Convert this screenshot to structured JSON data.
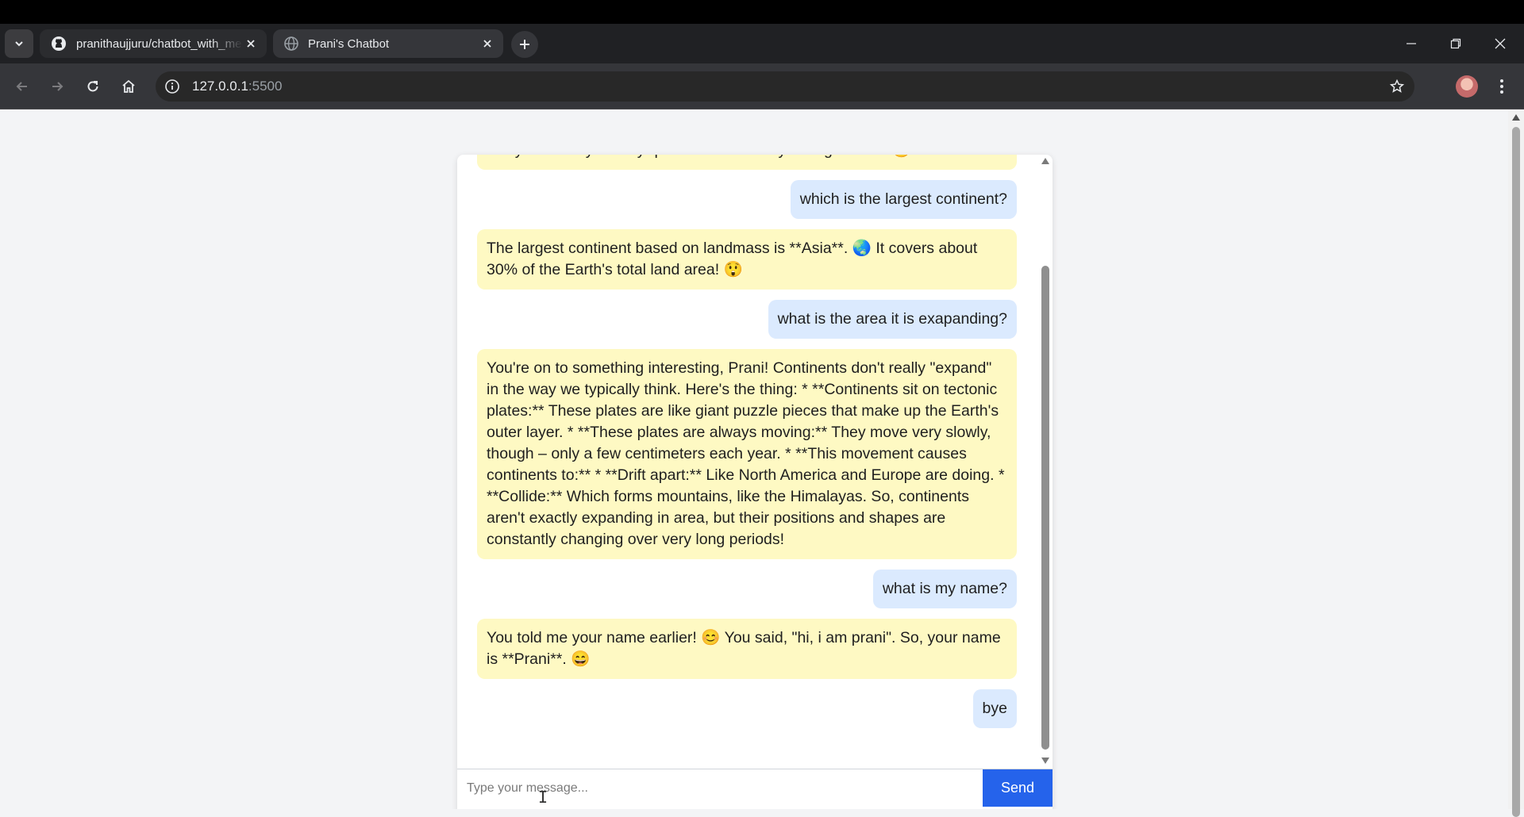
{
  "browser": {
    "tabs": [
      {
        "title": "pranithaujjuru/chatbot_with_memory",
        "icon": "github-icon",
        "active": false
      },
      {
        "title": "Prani's Chatbot",
        "icon": "globe-icon",
        "active": true
      }
    ],
    "url_host": "127.0.0.1",
    "url_port": ":5500"
  },
  "chat": {
    "messages": [
      {
        "role": "bot",
        "text": "away. I'm ready for any questions or tasks you might have. 😊"
      },
      {
        "role": "user",
        "text": "which is the largest continent?"
      },
      {
        "role": "bot",
        "text": "The largest continent based on landmass is **Asia**. 🌏 It covers about 30% of the Earth's total land area! 😲"
      },
      {
        "role": "user",
        "text": "what is the area it is exapanding?"
      },
      {
        "role": "bot",
        "text": "You're on to something interesting, Prani! Continents don't really \"expand\" in the way we typically think. Here's the thing: * **Continents sit on tectonic plates:** These plates are like giant puzzle pieces that make up the Earth's outer layer. * **These plates are always moving:** They move very slowly, though – only a few centimeters each year. * **This movement causes continents to:** * **Drift apart:** Like North America and Europe are doing. * **Collide:** Which forms mountains, like the Himalayas. So, continents aren't exactly expanding in area, but their positions and shapes are constantly changing over very long periods!"
      },
      {
        "role": "user",
        "text": "what is my name?"
      },
      {
        "role": "bot",
        "text": "You told me your name earlier! 😊 You said, \"hi, i am prani\". So, your name is **Prani**. 😄"
      },
      {
        "role": "user",
        "text": "bye"
      }
    ],
    "input_placeholder": "Type your message...",
    "input_value": "",
    "send_label": "Send"
  },
  "colors": {
    "bot_bubble": "#fef9c3",
    "user_bubble": "#dbeafe",
    "send_button": "#2563eb",
    "page_bg": "#f3f4f6"
  }
}
